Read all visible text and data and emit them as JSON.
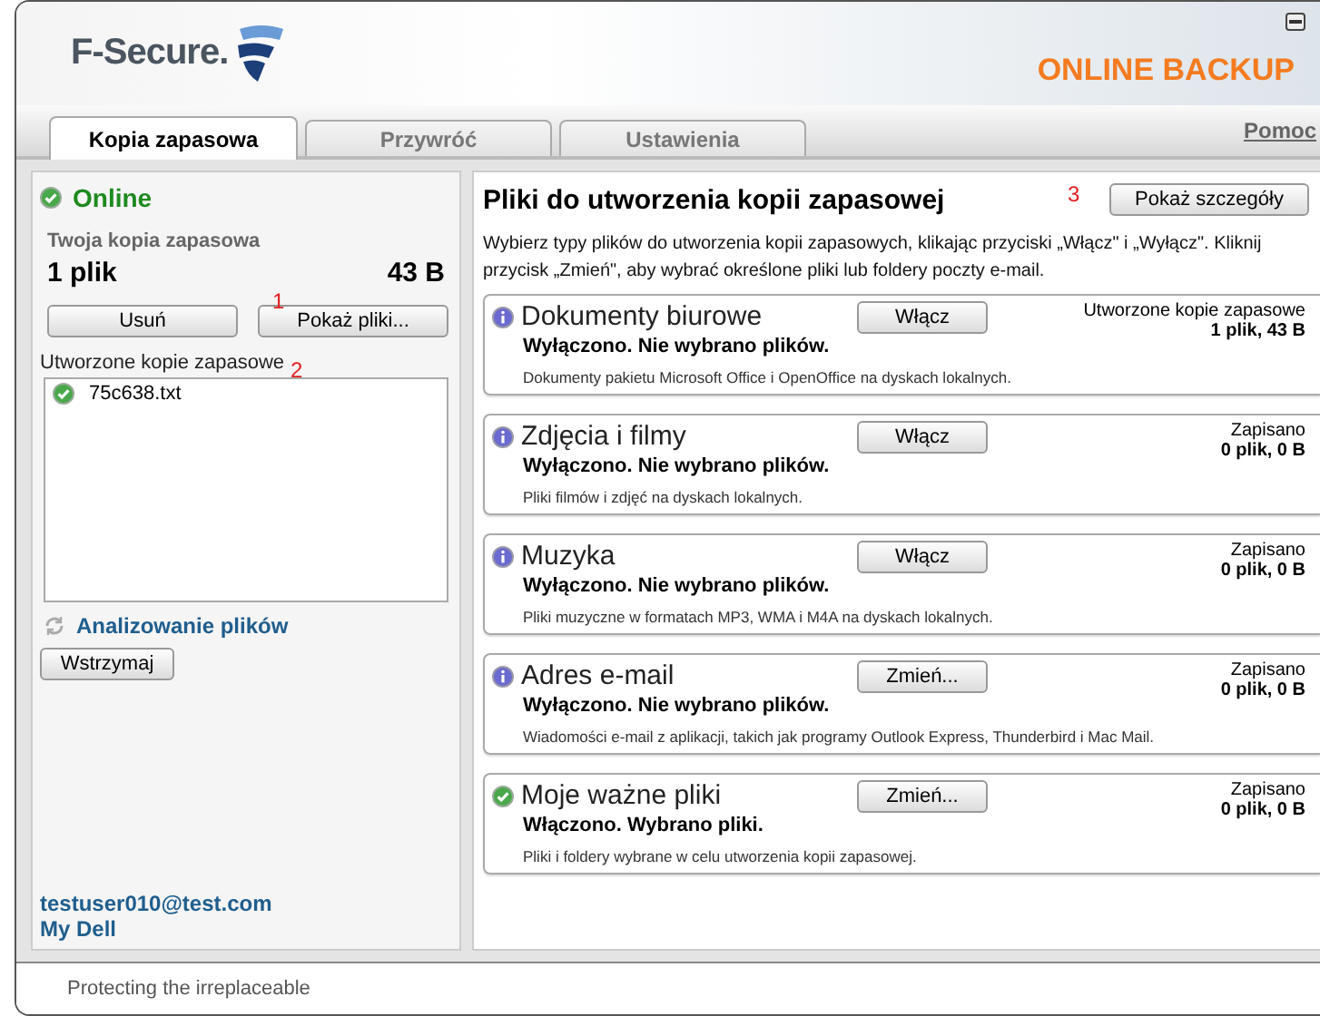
{
  "header": {
    "brand": "F-Secure.",
    "product": "ONLINE BACKUP"
  },
  "tabs": [
    {
      "label": "Kopia zapasowa",
      "selected": true
    },
    {
      "label": "Przywróć",
      "selected": false
    },
    {
      "label": "Ustawienia",
      "selected": false
    }
  ],
  "help_link": "Pomoc",
  "sidebar": {
    "status": "Online",
    "backup_title": "Twoja kopia zapasowa",
    "file_count": "1 plik",
    "size": "43 B",
    "buttons": [
      {
        "label": "Usuń"
      },
      {
        "label": "Pokaż pliki...",
        "annotation": "1"
      }
    ],
    "list_label": "Utworzone kopie zapasowe",
    "list_annotation": "2",
    "files": [
      {
        "name": "75c638.txt"
      }
    ],
    "activity": "Analizowanie plików",
    "pause_button": "Wstrzymaj",
    "account": "testuser010@test.com",
    "account_link": "My Dell"
  },
  "main": {
    "title": "Pliki do utworzenia kopii zapasowej",
    "details_annotation": "3",
    "details_button": "Pokaż szczegóły",
    "intro": "Wybierz typy plików do utworzenia kopii zapasowych, klikając przyciski „Włącz\" i „Wyłącz\". Kliknij przycisk „Zmień\", aby wybrać określone pliki lub foldery poczty e-mail.",
    "categories": [
      {
        "name": "Dokumenty biurowe",
        "enabled": false,
        "button": "Włącz",
        "status": "Wyłączono. Nie wybrano plików.",
        "stat_label": "Utworzone kopie zapasowe",
        "stat_value": "1 plik, 43 B",
        "description": "Dokumenty pakietu Microsoft Office i OpenOffice na dyskach lokalnych."
      },
      {
        "name": "Zdjęcia i filmy",
        "enabled": false,
        "button": "Włącz",
        "status": "Wyłączono. Nie wybrano plików.",
        "stat_label": "Zapisano",
        "stat_value": "0 plik, 0 B",
        "description": "Pliki filmów i zdjęć na dyskach lokalnych."
      },
      {
        "name": "Muzyka",
        "enabled": false,
        "button": "Włącz",
        "status": "Wyłączono. Nie wybrano plików.",
        "stat_label": "Zapisano",
        "stat_value": "0 plik, 0 B",
        "description": "Pliki muzyczne w formatach MP3, WMA i M4A na dyskach lokalnych."
      },
      {
        "name": "Adres e-mail",
        "enabled": false,
        "button": "Zmień...",
        "status": "Wyłączono. Nie wybrano plików.",
        "stat_label": "Zapisano",
        "stat_value": "0 plik, 0 B",
        "description": "Wiadomości e-mail z aplikacji, takich jak programy Outlook Express, Thunderbird i Mac Mail."
      },
      {
        "name": "Moje ważne pliki",
        "enabled": true,
        "button": "Zmień...",
        "status": "Włączono. Wybrano pliki.",
        "stat_label": "Zapisano",
        "stat_value": "0 plik, 0 B",
        "description": "Pliki i foldery wybrane w celu utworzenia kopii zapasowej."
      }
    ]
  },
  "footer": {
    "tagline": "Protecting the irreplaceable"
  }
}
